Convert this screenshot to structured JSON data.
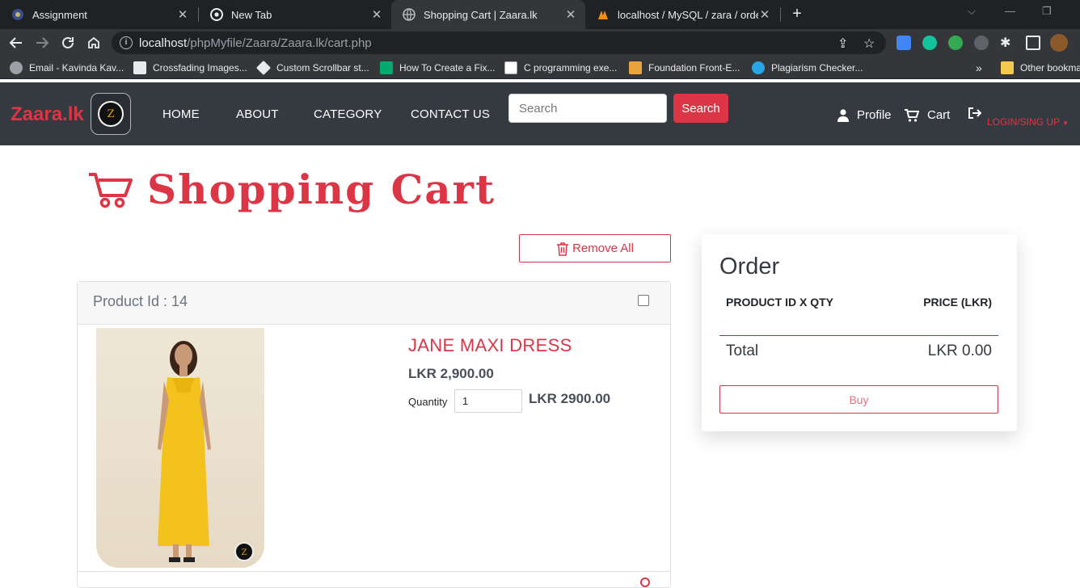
{
  "browser": {
    "tabs": [
      {
        "title": "Assignment",
        "active": false
      },
      {
        "title": "New Tab",
        "active": false
      },
      {
        "title": "Shopping Cart | Zaara.lk",
        "active": true
      },
      {
        "title": "localhost / MySQL / zara / order_",
        "active": false
      }
    ],
    "url_host": "localhost",
    "url_path": "/phpMyfile/Zaara/Zaara.lk/cart.php",
    "bookmarks": [
      "Email - Kavinda Kav...",
      "Crossfading Images...",
      "Custom Scrollbar st...",
      "How To Create a Fix...",
      "C programming exe...",
      "Foundation Front-E...",
      "Plagiarism Checker..."
    ],
    "bookmarks_more": "»",
    "other_bookmarks": "Other bookma"
  },
  "site": {
    "brand": "Zaara.lk",
    "logo_glyph": "Z",
    "nav": [
      "HOME",
      "ABOUT",
      "CATEGORY",
      "CONTACT US"
    ],
    "search_placeholder": "Search",
    "search_button": "Search",
    "profile_label": "Profile",
    "cart_label": "Cart",
    "login_label": "LOGIN/SING UP",
    "accent_color": "#dc3545"
  },
  "cart": {
    "heading": "Shopping Cart",
    "remove_all": "Remove All",
    "items": [
      {
        "product_id_label": "Product Id : 14",
        "name": "JANE MAXI DRESS",
        "price": "LKR 2,900.00",
        "quantity_label": "Quantity",
        "quantity": "1",
        "line_total": "LKR 2900.00"
      }
    ]
  },
  "order": {
    "title": "Order",
    "col_left": "PRODUCT ID X QTY",
    "col_right": "PRICE (LKR)",
    "total_label": "Total",
    "total_value": "LKR 0.00",
    "buy_label": "Buy"
  }
}
